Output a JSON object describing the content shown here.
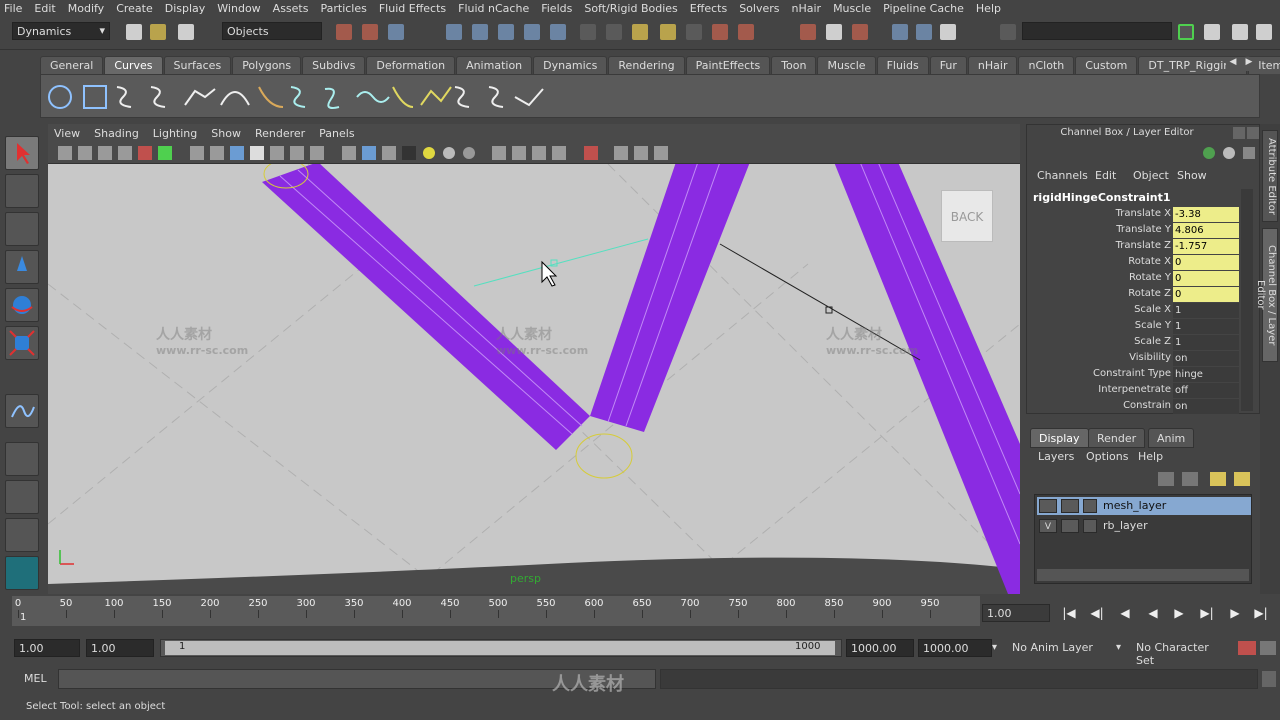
{
  "menubar": [
    "File",
    "Edit",
    "Modify",
    "Create",
    "Display",
    "Window",
    "Assets",
    "Particles",
    "Fluid Effects",
    "Fluid nCache",
    "Fields",
    "Soft/Rigid Bodies",
    "Effects",
    "Solvers",
    "nHair",
    "Muscle",
    "Pipeline Cache",
    "Help"
  ],
  "statusline": {
    "menuset": "Dynamics",
    "selection_mode": "Objects"
  },
  "shelf": {
    "tabs": [
      "General",
      "Curves",
      "Surfaces",
      "Polygons",
      "Subdivs",
      "Deformation",
      "Animation",
      "Dynamics",
      "Rendering",
      "PaintEffects",
      "Toon",
      "Muscle",
      "Fluids",
      "Fur",
      "nHair",
      "nCloth",
      "Custom",
      "DT_TRP_Rigging",
      "Item"
    ],
    "active_tab": "Curves"
  },
  "viewport": {
    "menus": [
      "View",
      "Shading",
      "Lighting",
      "Show",
      "Renderer",
      "Panels"
    ],
    "camera_label": "persp",
    "viewcube_label": "BACK",
    "colors": {
      "bg": "#c8c8c8",
      "mesh": "#8a2be2",
      "floor": "#4a4a4a"
    }
  },
  "channelbox": {
    "title": "Channel Box / Layer Editor",
    "menus": [
      "Channels",
      "Edit",
      "Object",
      "Show"
    ],
    "object_name": "rigidHingeConstraint1",
    "channels": [
      {
        "label": "Translate X",
        "value": "-3.38",
        "highlight": true
      },
      {
        "label": "Translate Y",
        "value": "4.806",
        "highlight": true
      },
      {
        "label": "Translate Z",
        "value": "-1.757",
        "highlight": true
      },
      {
        "label": "Rotate X",
        "value": "0",
        "highlight": true
      },
      {
        "label": "Rotate Y",
        "value": "0",
        "highlight": true
      },
      {
        "label": "Rotate Z",
        "value": "0",
        "highlight": true
      },
      {
        "label": "Scale X",
        "value": "1",
        "highlight": false
      },
      {
        "label": "Scale Y",
        "value": "1",
        "highlight": false
      },
      {
        "label": "Scale Z",
        "value": "1",
        "highlight": false
      },
      {
        "label": "Visibility",
        "value": "on",
        "highlight": false
      },
      {
        "label": "Constraint Type",
        "value": "hinge",
        "highlight": false
      },
      {
        "label": "Interpenetrate",
        "value": "off",
        "highlight": false
      },
      {
        "label": "Constrain",
        "value": "on",
        "highlight": false
      }
    ]
  },
  "side_tabs": [
    "Attribute Editor",
    "Channel Box / Layer Editor"
  ],
  "layereditor": {
    "tabs": [
      "Display",
      "Render",
      "Anim"
    ],
    "active_tab": "Display",
    "menus": [
      "Layers",
      "Options",
      "Help"
    ],
    "layers": [
      {
        "name": "mesh_layer",
        "vis": "",
        "selected": true
      },
      {
        "name": "rb_layer",
        "vis": "V",
        "selected": false
      }
    ]
  },
  "timeslider": {
    "ticks": [
      0,
      50,
      100,
      150,
      200,
      250,
      300,
      350,
      400,
      450,
      500,
      550,
      600,
      650,
      700,
      750,
      800,
      850,
      900,
      950
    ],
    "min": 0,
    "max": 1000,
    "current_label": "1",
    "current_frame": "1.00"
  },
  "rangeslider": {
    "start": "1.00",
    "playback_start": "1.00",
    "range_start_label": "1",
    "range_end_label": "1000",
    "playback_end": "1000.00",
    "end": "1000.00",
    "anim_layer": "No Anim Layer",
    "character_set": "No Character Set"
  },
  "commandline": {
    "label": "MEL"
  },
  "helpline": {
    "text": "Select Tool: select an object"
  },
  "watermark": {
    "line1": "人人素材",
    "line2": "www.rr-sc.com",
    "logo": "人人素材"
  }
}
